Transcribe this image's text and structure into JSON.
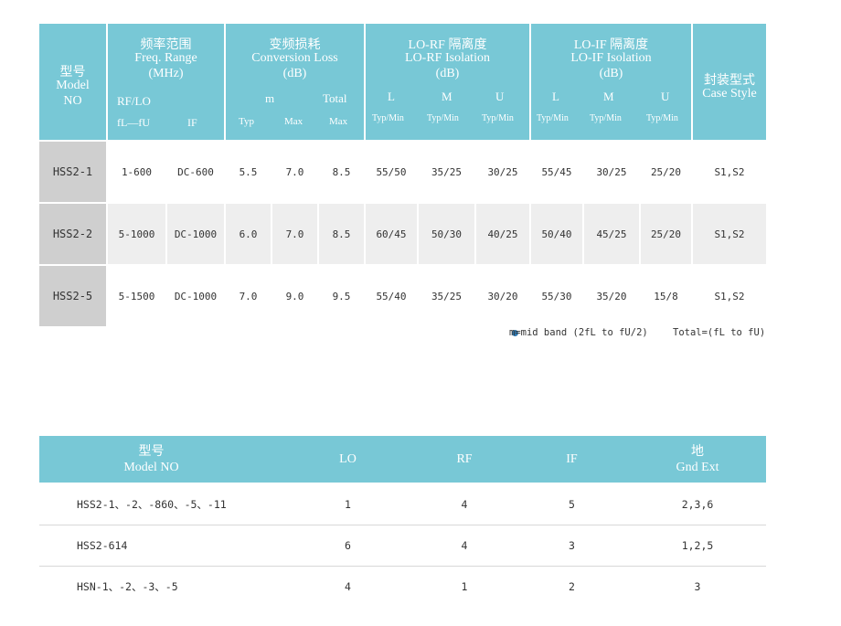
{
  "spec_table": {
    "headers": {
      "model": [
        "型号",
        "Model",
        "NO"
      ],
      "freq": [
        "频率范围",
        "Freq. Range",
        "(MHz)"
      ],
      "freq_sub": [
        "RF/LO",
        "fL—fU",
        "IF"
      ],
      "conv": [
        "变频损耗",
        "Conversion Loss",
        "(dB)"
      ],
      "conv_sub": [
        "m",
        "Total"
      ],
      "conv_sub2": [
        "Typ",
        "Max",
        "Max"
      ],
      "lorf": [
        "LO-RF 隔离度",
        "LO-RF Isolation",
        "(dB)"
      ],
      "lorf_sub": [
        "L",
        "M",
        "U"
      ],
      "loif": [
        "LO-IF 隔离度",
        "LO-IF Isolation",
        "(dB)"
      ],
      "loif_sub": [
        "L",
        "M",
        "U"
      ],
      "typmin": "Typ/Min",
      "case": [
        "封装型式",
        "Case Style"
      ]
    },
    "rows": [
      {
        "model": "HSS2-1",
        "rflo": "1-600",
        "if": "DC-600",
        "typ": "5.5",
        "max": "7.0",
        "total": "8.5",
        "lorf_l": "55/50",
        "lorf_m": "35/25",
        "lorf_u": "30/25",
        "loif_l": "55/45",
        "loif_m": "30/25",
        "loif_u": "25/20",
        "case": "S1,S2"
      },
      {
        "model": "HSS2-2",
        "rflo": "5-1000",
        "if": "DC-1000",
        "typ": "6.0",
        "max": "7.0",
        "total": "8.5",
        "lorf_l": "60/45",
        "lorf_m": "50/30",
        "lorf_u": "40/25",
        "loif_l": "50/40",
        "loif_m": "45/25",
        "loif_u": "25/20",
        "case": "S1,S2"
      },
      {
        "model": "HSS2-5",
        "rflo": "5-1500",
        "if": "DC-1000",
        "typ": "7.0",
        "max": "9.0",
        "total": "9.5",
        "lorf_l": "55/40",
        "lorf_m": "35/25",
        "lorf_u": "30/20",
        "loif_l": "55/30",
        "loif_m": "35/20",
        "loif_u": "15/8",
        "case": "S1,S2"
      }
    ],
    "notes": {
      "mid_band": "m=mid band (2fL to fU/2)",
      "total": "Total=(fL to fU)"
    }
  },
  "pin_table": {
    "headers": {
      "model": [
        "型号",
        "Model NO"
      ],
      "lo": "LO",
      "rf": "RF",
      "if": "IF",
      "gnd": [
        "地",
        "Gnd Ext"
      ]
    },
    "rows": [
      {
        "model": "HSS2-1、-2、-860、-5、-11",
        "lo": "1",
        "rf": "4",
        "if": "5",
        "gnd": "2,3,6"
      },
      {
        "model": "HSS2-614",
        "lo": "6",
        "rf": "4",
        "if": "3",
        "gnd": "1,2,5"
      },
      {
        "model": "HSN-1、-2、-3、-5",
        "lo": "4",
        "rf": "1",
        "if": "2",
        "gnd": "3"
      }
    ]
  },
  "colors": {
    "header_bg": "#78c8d6",
    "model_bg": "#cfcfcf",
    "alt_row_bg": "#eeeeee",
    "note_dot": "#2f78b0"
  }
}
